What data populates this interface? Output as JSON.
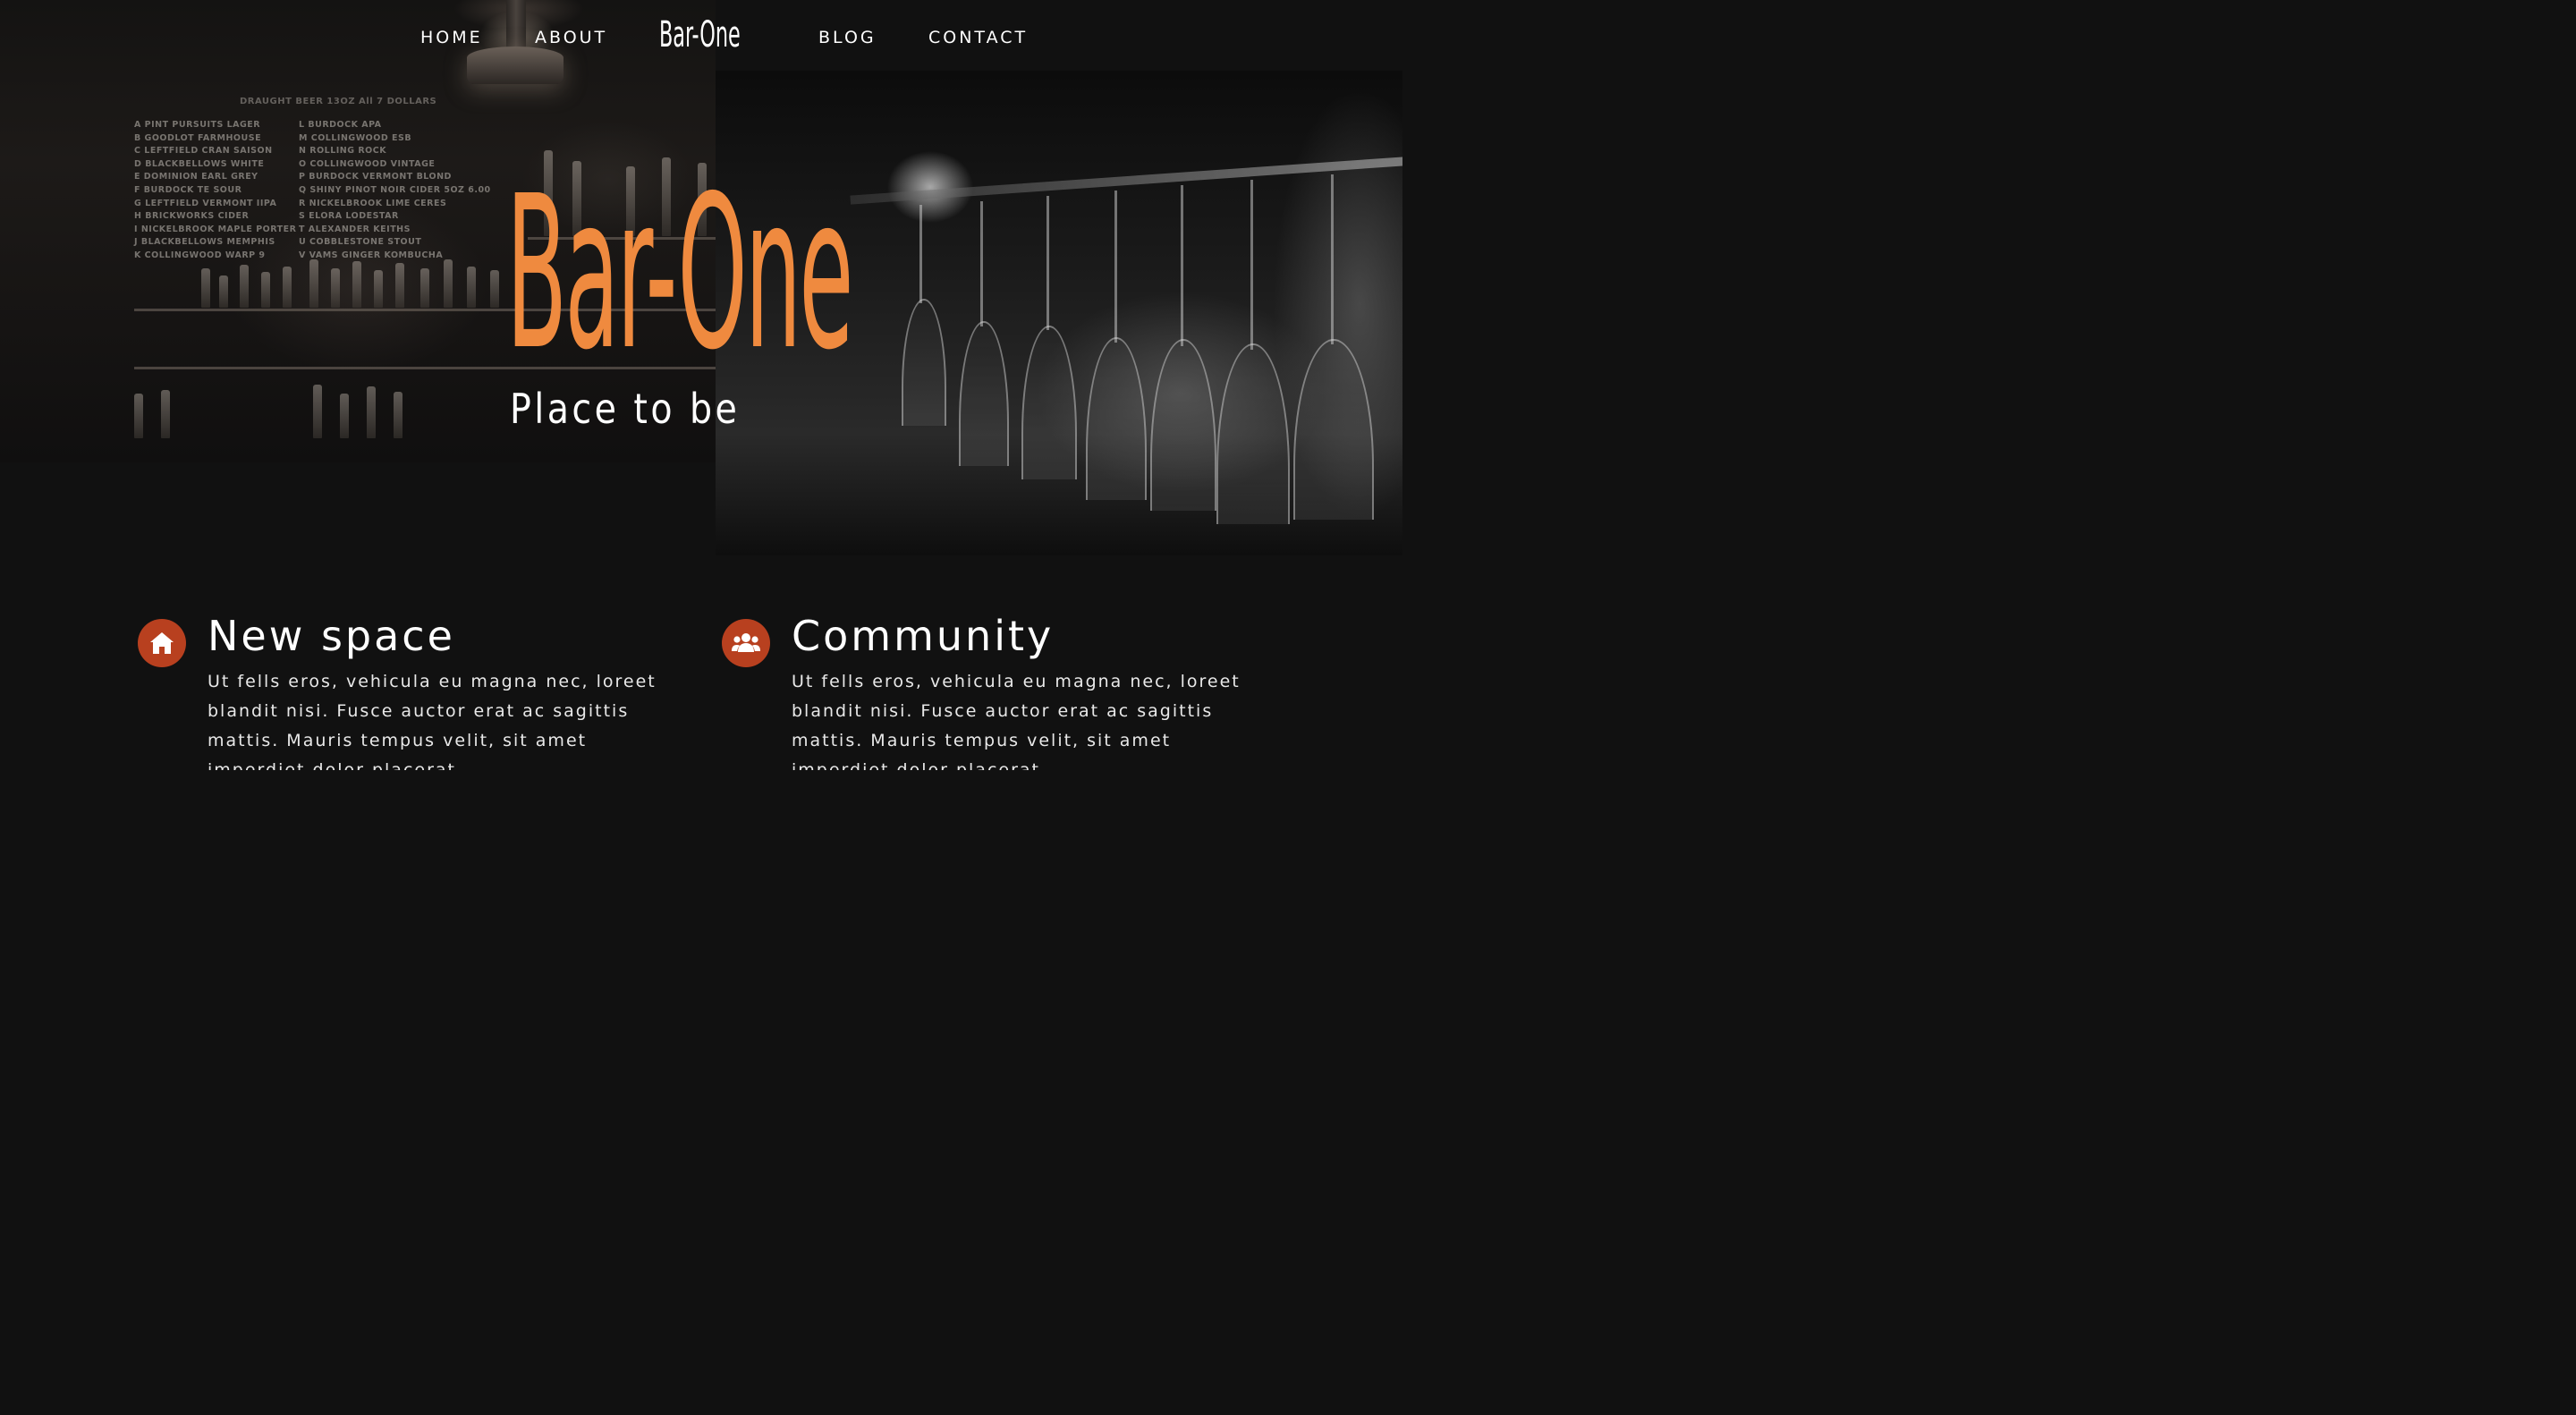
{
  "nav": {
    "links_left": [
      {
        "label": "HOME"
      },
      {
        "label": "ABOUT"
      }
    ],
    "logo": "Bar-One",
    "links_right": [
      {
        "label": "BLOG"
      },
      {
        "label": "CONTACT"
      }
    ]
  },
  "hero": {
    "title": "Bar-One",
    "subtitle": "Place to be",
    "title_color": "#ef8a3f"
  },
  "menu_board": {
    "heading": "DRAUGHT   BEER          13OZ    All 7 DOLLARS",
    "col1": [
      "A PINT PURSUITS  LAGER",
      "B GOODLOT    FARMHOUSE",
      "C LEFTFIELD CRAN  SAISON",
      "D BLACKBELLOWS  WHITE",
      "E DOMINION EARL  GREY",
      "F BURDOCK  TE    SOUR",
      "G LEFTFIELD  VERMONT IIPA",
      "H BRICKWORKS  CIDER",
      "I  NICKELBROOK MAPLE PORTER",
      "J BLACKBELLOWS MEMPHIS",
      "K COLLINGWOOD  WARP 9"
    ],
    "col2": [
      "L  BURDOCK   APA",
      "M COLLINGWOOD  ESB",
      "N ROLLING ROCK",
      "O COLLINGWOOD  VINTAGE",
      "P BURDOCK VERMONT BLOND",
      "Q SHINY PINOT NOIR CIDER  5OZ    6.00",
      "R NICKELBROOK  LIME  CERES",
      "S ELORA LODESTAR",
      "T ALEXANDER  KEITHS",
      "U COBBLESTONE  STOUT",
      "V VAMS GINGER KOMBUCHA"
    ]
  },
  "features": [
    {
      "icon": "home-icon",
      "title": "New space",
      "text": "Ut fells eros, vehicula eu magna nec, loreet blandit nisi. Fusce auctor erat ac sagittis mattis. Mauris tempus velit, sit amet imperdiet dolor placerat."
    },
    {
      "icon": "users-icon",
      "title": "Community",
      "text": "Ut fells eros, vehicula eu magna nec, loreet blandit nisi. Fusce auctor erat ac sagittis mattis. Mauris tempus velit, sit amet imperdiet dolor placerat."
    }
  ],
  "colors": {
    "background": "#111111",
    "accent": "#ef8a3f",
    "icon_bg": "#b8401f"
  }
}
